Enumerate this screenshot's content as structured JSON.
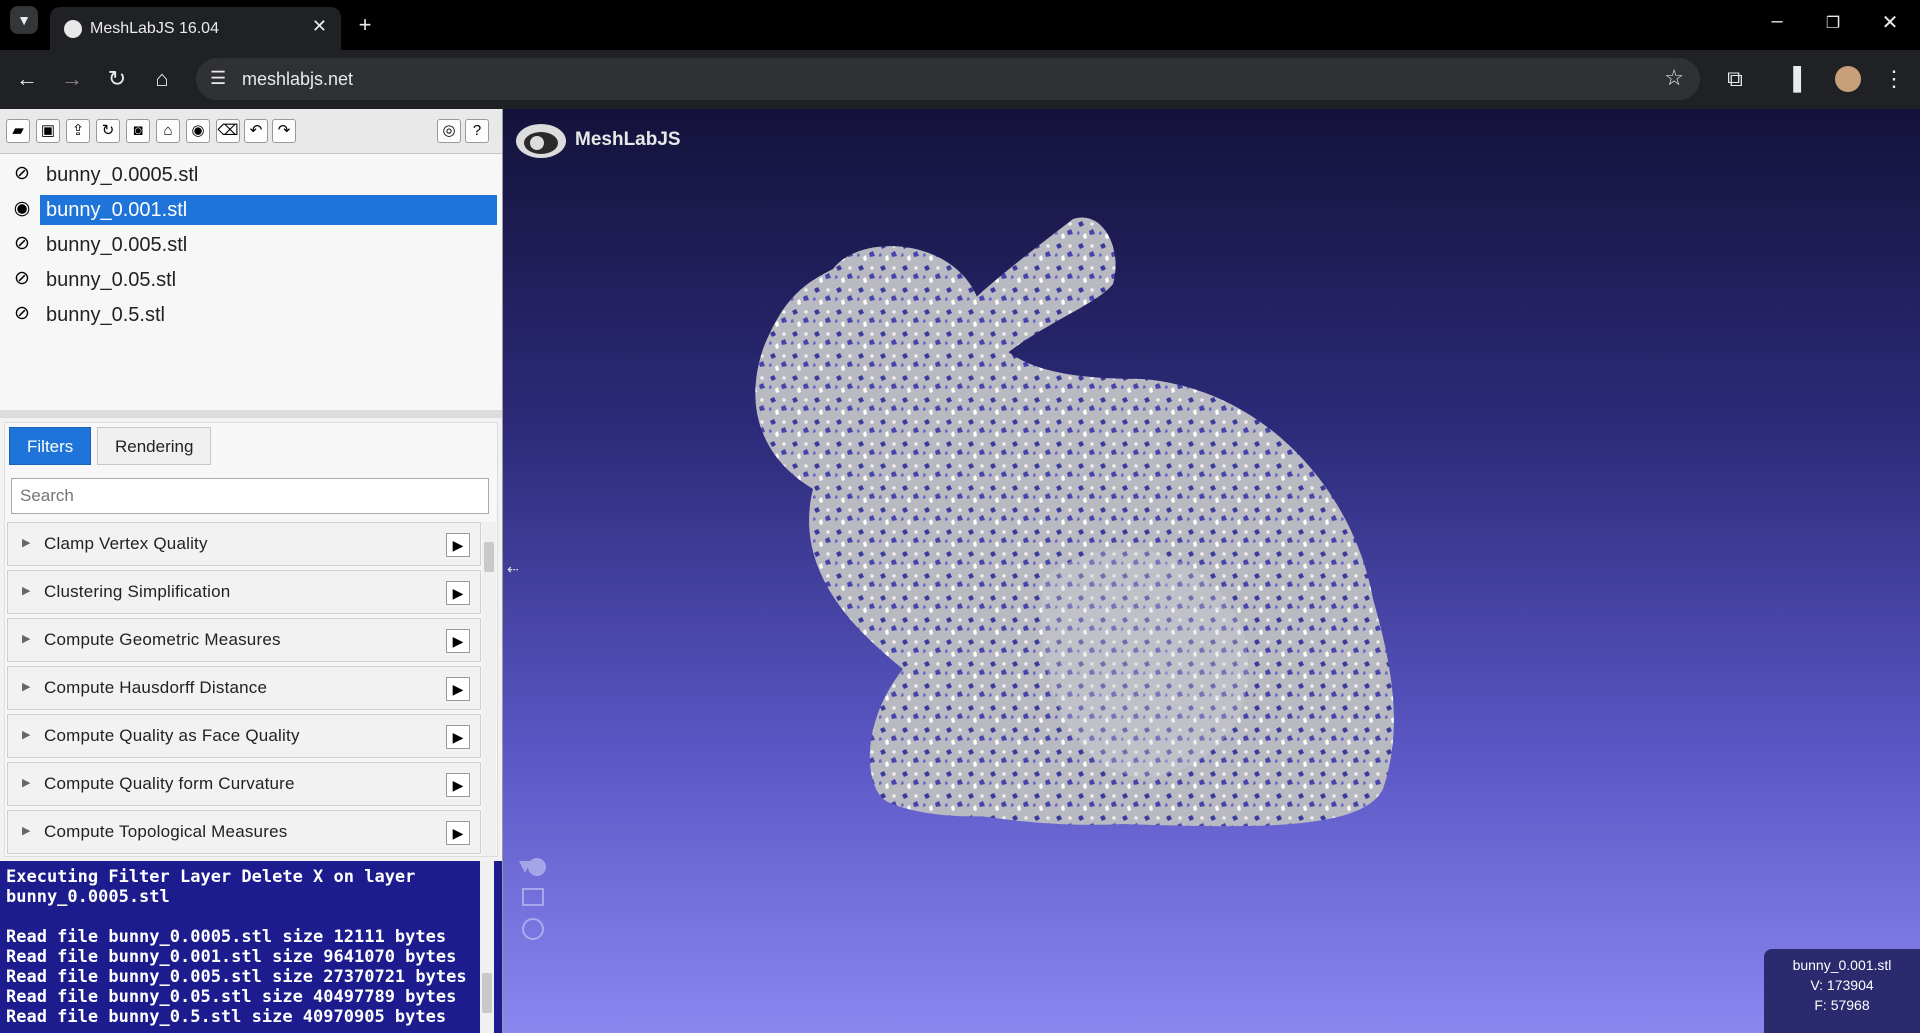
{
  "browser": {
    "tab_title": "MeshLabJS 16.04",
    "url": "meshlabjs.net",
    "icons": {
      "tab_menu": "chevron-down-icon",
      "favicon": "meshlab-favicon-icon",
      "tab_close": "close-icon",
      "new_tab": "plus-icon",
      "back": "back-arrow-icon",
      "forward": "forward-arrow-icon",
      "reload": "reload-icon",
      "home": "home-icon",
      "site_info": "site-settings-icon",
      "bookmark": "star-icon",
      "extensions": "puzzle-icon",
      "sidebar": "sidebar-icon",
      "profile": "avatar",
      "menu": "kebab-menu-icon",
      "minimize": "minimize-icon",
      "restore": "restore-icon",
      "close_window": "close-window-icon"
    }
  },
  "app": {
    "toolbar_icons": [
      "open-icon",
      "save-icon",
      "export-icon",
      "reload-icon",
      "snapshot-icon",
      "home-icon",
      "camera-icon",
      "delete-icon",
      "undo-icon",
      "redo-icon",
      "github-icon",
      "help-icon"
    ],
    "layers": [
      {
        "name": "bunny_0.0005.stl",
        "visible": false,
        "selected": false
      },
      {
        "name": "bunny_0.001.stl",
        "visible": true,
        "selected": true
      },
      {
        "name": "bunny_0.005.stl",
        "visible": false,
        "selected": false
      },
      {
        "name": "bunny_0.05.stl",
        "visible": false,
        "selected": false
      },
      {
        "name": "bunny_0.5.stl",
        "visible": false,
        "selected": false
      }
    ],
    "tabs": {
      "filters": "Filters",
      "rendering": "Rendering"
    },
    "search_placeholder": "Search",
    "filters": [
      "Clamp Vertex Quality",
      "Clustering Simplification",
      "Compute Geometric Measures",
      "Compute Hausdorff Distance",
      "Compute Quality as Face Quality",
      "Compute Quality form Curvature",
      "Compute Topological Measures"
    ],
    "log_lines": [
      "Executing Filter Layer Delete X on layer",
      "bunny_0.0005.stl",
      "",
      "Read file bunny_0.0005.stl size 12111 bytes",
      "Read file bunny_0.001.stl size 9641070 bytes",
      "Read file bunny_0.005.stl size 27370721 bytes",
      "Read file bunny_0.05.stl size 40497789 bytes",
      "Read file bunny_0.5.stl size 40970905 bytes"
    ],
    "viewer": {
      "logo_text": "MeshLabJS",
      "info": {
        "file": "bunny_0.001.stl",
        "vertices": "V: 173904",
        "faces": "F: 57968"
      },
      "colors": {
        "background_top": "#14123a",
        "background_bottom": "#8a87ef",
        "mesh": "#b8b8c0",
        "selection": "#1e74d8"
      }
    }
  }
}
